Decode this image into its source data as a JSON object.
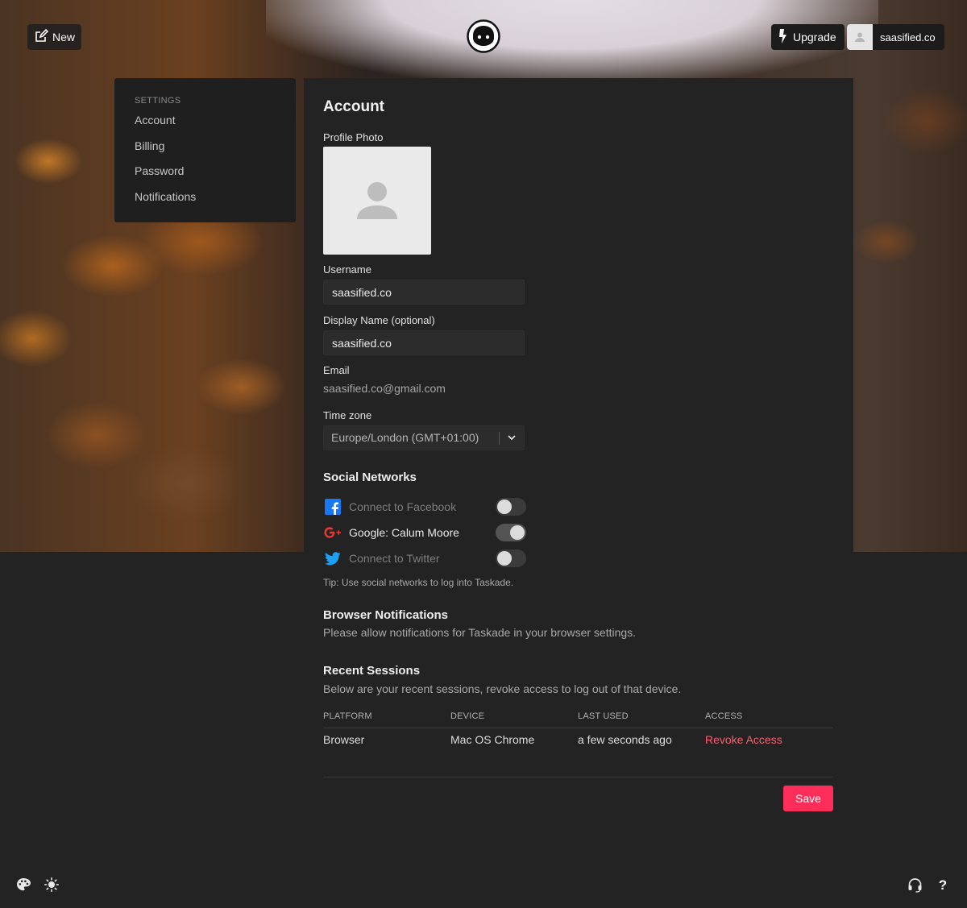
{
  "topbar": {
    "new_label": "New",
    "upgrade_label": "Upgrade",
    "username": "saasified.co"
  },
  "sidebar": {
    "heading": "SETTINGS",
    "items": [
      {
        "label": "Account"
      },
      {
        "label": "Billing"
      },
      {
        "label": "Password"
      },
      {
        "label": "Notifications"
      }
    ]
  },
  "account": {
    "title": "Account",
    "profile_photo_label": "Profile Photo",
    "username_label": "Username",
    "username_value": "saasified.co",
    "display_name_label": "Display Name (optional)",
    "display_name_value": "saasified.co",
    "email_label": "Email",
    "email_value": "saasified.co@gmail.com",
    "timezone_label": "Time zone",
    "timezone_value": "Europe/London (GMT+01:00)"
  },
  "social": {
    "title": "Social Networks",
    "networks": [
      {
        "label": "Connect to Facebook",
        "icon": "facebook-icon",
        "connected": false,
        "color": "#1877f2"
      },
      {
        "label": "Google: Calum Moore",
        "icon": "google-plus-icon",
        "connected": true,
        "color": "#e53935"
      },
      {
        "label": "Connect to Twitter",
        "icon": "twitter-icon",
        "connected": false,
        "color": "#1da1f2"
      }
    ],
    "tip": "Tip: Use social networks to log into Taskade."
  },
  "browser_notifications": {
    "title": "Browser Notifications",
    "description": "Please allow notifications for Taskade in your browser settings."
  },
  "sessions": {
    "title": "Recent Sessions",
    "description": "Below are your recent sessions, revoke access to log out of that device.",
    "columns": [
      "PLATFORM",
      "DEVICE",
      "LAST USED",
      "ACCESS"
    ],
    "rows": [
      {
        "platform": "Browser",
        "device": "Mac OS Chrome",
        "last_used": "a few seconds ago",
        "access": "Revoke Access"
      }
    ]
  },
  "save_label": "Save",
  "colors": {
    "accent": "#ff2d5a",
    "revoke": "#ff5c6c",
    "panel": "#232323"
  },
  "footer": {
    "left_icons": [
      "palette-icon",
      "sun-icon"
    ],
    "right_icons": [
      "headset-icon",
      "help-icon"
    ],
    "help_glyph": "?"
  }
}
